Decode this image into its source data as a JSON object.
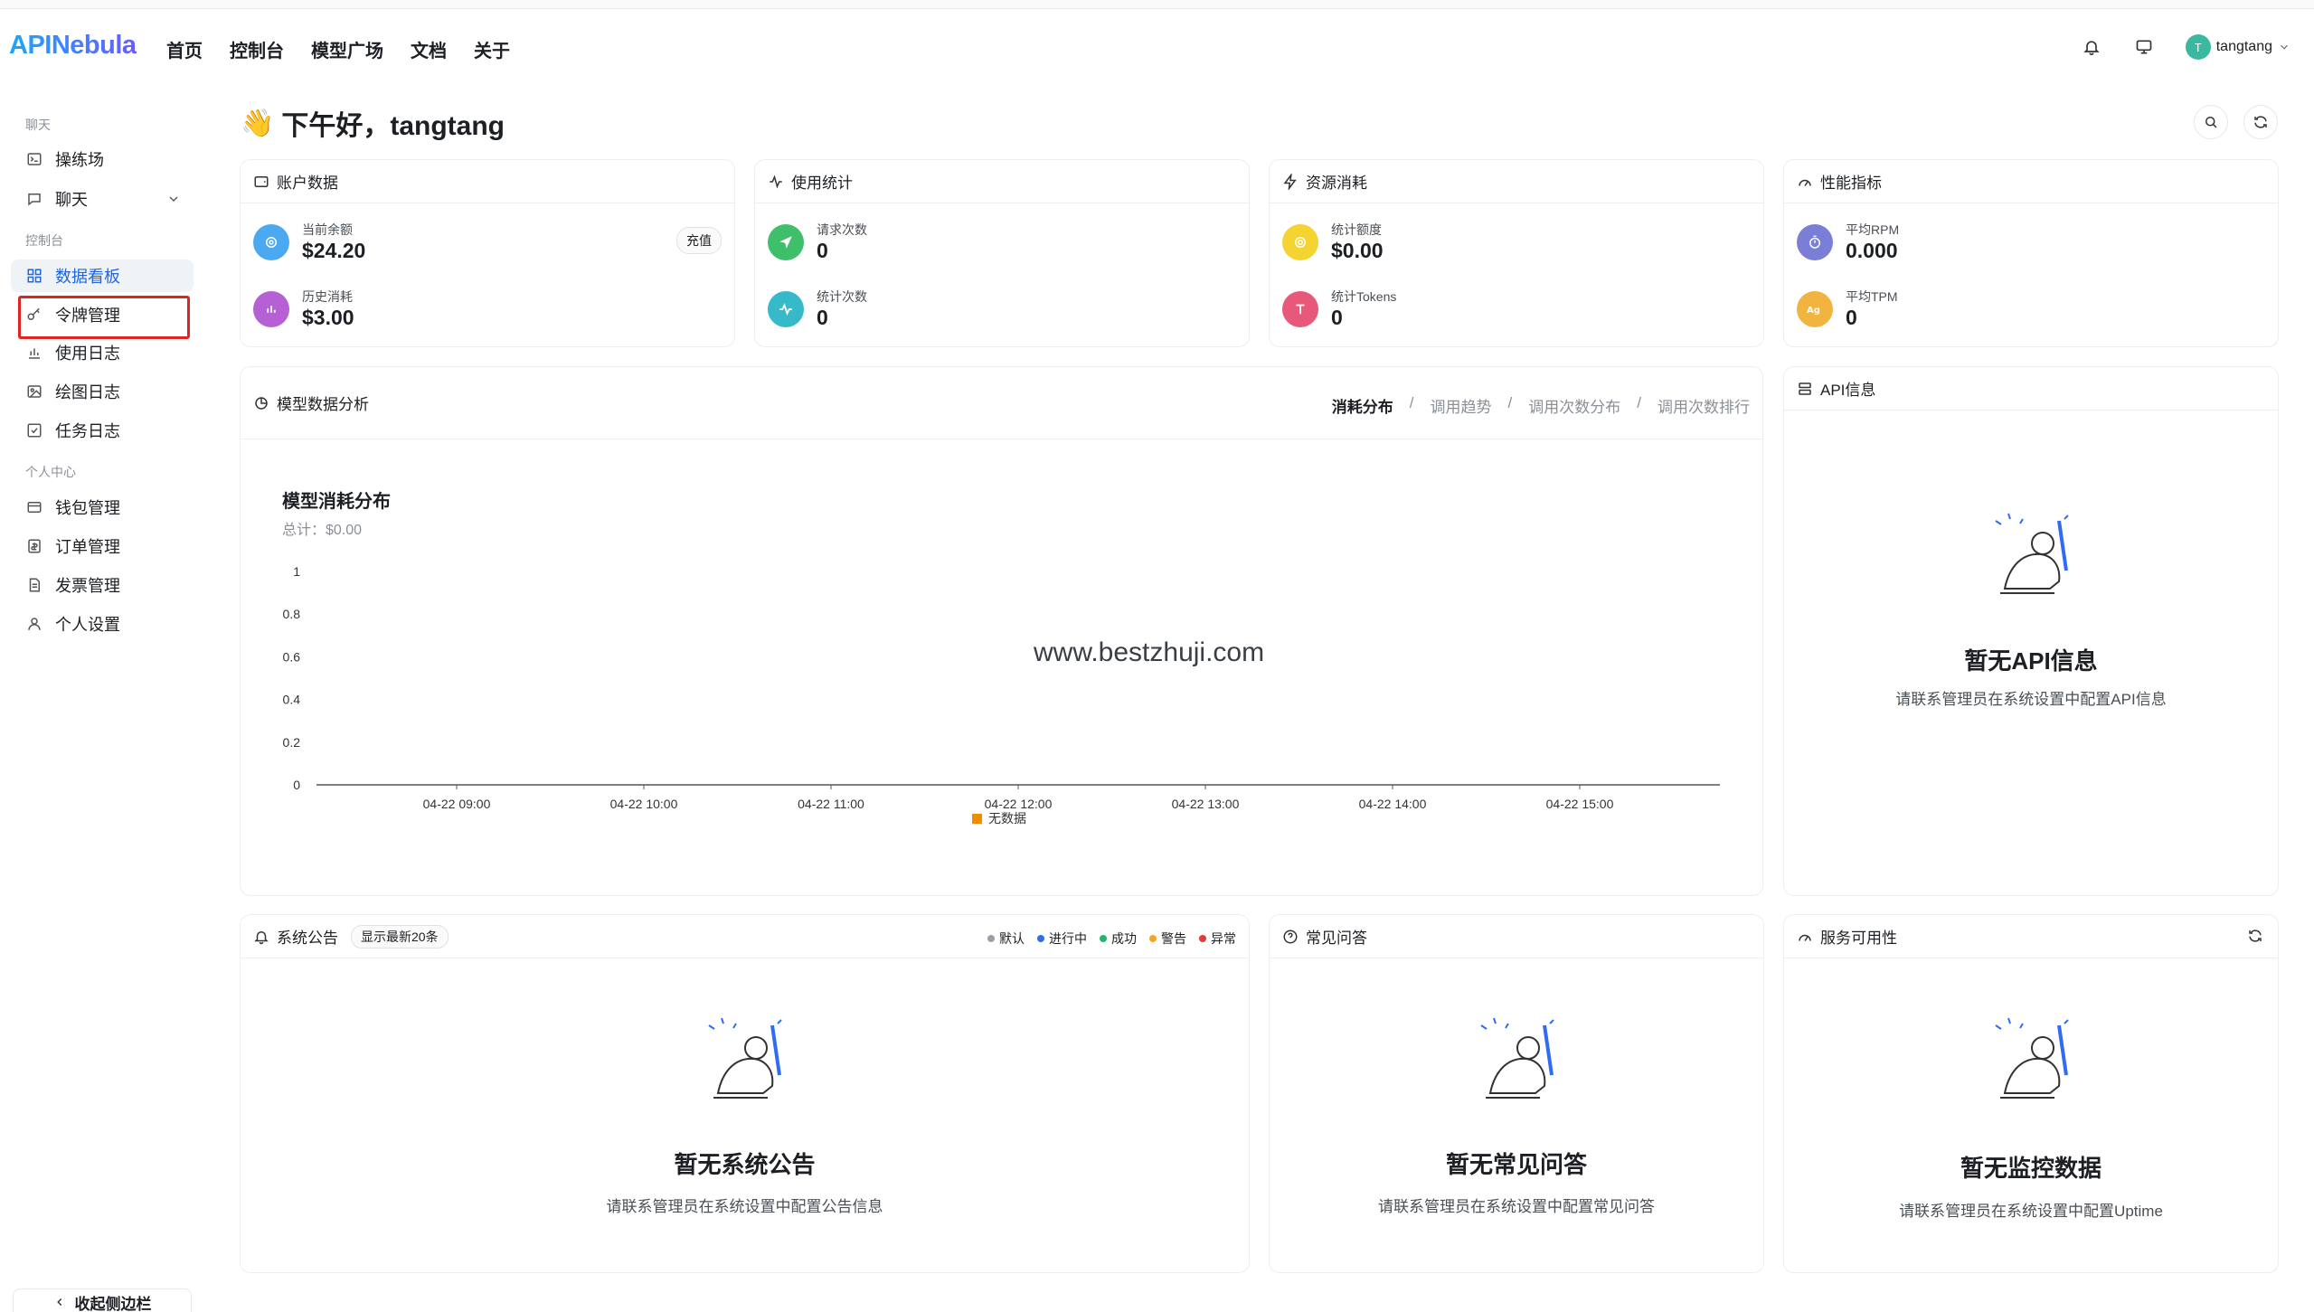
{
  "nav": {
    "logo": "APINebula",
    "links": [
      "首页",
      "控制台",
      "模型广场",
      "文档",
      "关于"
    ],
    "user": {
      "avatar_letter": "T",
      "name": "tangtang"
    }
  },
  "sidebar": {
    "groups": [
      "聊天",
      "控制台",
      "个人中心"
    ],
    "items": [
      {
        "label": "操练场",
        "icon": "terminal-icon"
      },
      {
        "label": "聊天",
        "icon": "chat-icon"
      },
      {
        "label": "数据看板",
        "icon": "grid-icon",
        "active": true
      },
      {
        "label": "令牌管理",
        "icon": "key-icon",
        "highlighted": true
      },
      {
        "label": "使用日志",
        "icon": "bar-chart-icon"
      },
      {
        "label": "绘图日志",
        "icon": "image-icon"
      },
      {
        "label": "任务日志",
        "icon": "check-square-icon"
      },
      {
        "label": "钱包管理",
        "icon": "wallet-icon"
      },
      {
        "label": "订单管理",
        "icon": "order-icon"
      },
      {
        "label": "发票管理",
        "icon": "invoice-icon"
      },
      {
        "label": "个人设置",
        "icon": "user-icon"
      }
    ],
    "collapse_label": "收起侧边栏"
  },
  "greeting": {
    "emoji": "👋",
    "text": "下午好，tangtang"
  },
  "cards": {
    "account": {
      "title": "账户数据",
      "balance_label": "当前余额",
      "balance": "$24.20",
      "recharge": "充值",
      "history_label": "历史消耗",
      "history": "$3.00"
    },
    "usage": {
      "title": "使用统计",
      "requests_label": "请求次数",
      "requests": "0",
      "count_label": "统计次数",
      "count": "0"
    },
    "resource": {
      "title": "资源消耗",
      "quota_label": "统计额度",
      "quota": "$0.00",
      "tokens_label": "统计Tokens",
      "tokens": "0"
    },
    "perf": {
      "title": "性能指标",
      "rpm_label": "平均RPM",
      "rpm": "0.000",
      "tpm_label": "平均TPM",
      "tpm": "0"
    }
  },
  "analysis": {
    "title": "模型数据分析",
    "tabs": [
      "消耗分布",
      "调用趋势",
      "调用次数分布",
      "调用次数排行"
    ],
    "tab_sep": "/",
    "watermark": "www.bestzhuji.com"
  },
  "chart_data": {
    "type": "bar",
    "title": "模型消耗分布",
    "subtitle": "总计：$0.00",
    "categories": [
      "04-22 09:00",
      "04-22 10:00",
      "04-22 11:00",
      "04-22 12:00",
      "04-22 13:00",
      "04-22 14:00",
      "04-22 15:00"
    ],
    "series": [
      {
        "name": "无数据",
        "values": [
          0,
          0,
          0,
          0,
          0,
          0,
          0
        ],
        "color": "#f08c00"
      }
    ],
    "yticks": [
      "1",
      "0.8",
      "0.6",
      "0.4",
      "0.2",
      "0"
    ],
    "ylim": [
      0,
      1
    ],
    "grid": false,
    "legend": "bottom"
  },
  "api_info": {
    "title": "API信息",
    "empty_title": "暂无API信息",
    "empty_desc": "请联系管理员在系统设置中配置API信息"
  },
  "announcements": {
    "title": "系统公告",
    "badge": "显示最新20条",
    "legend": [
      {
        "label": "默认",
        "color": "#9aa0a6"
      },
      {
        "label": "进行中",
        "color": "#2f6cf6"
      },
      {
        "label": "成功",
        "color": "#1fb86a"
      },
      {
        "label": "警告",
        "color": "#f5a623"
      },
      {
        "label": "异常",
        "color": "#e53935"
      }
    ],
    "empty_title": "暂无系统公告",
    "empty_desc": "请联系管理员在系统设置中配置公告信息"
  },
  "faq": {
    "title": "常见问答",
    "empty_title": "暂无常见问答",
    "empty_desc": "请联系管理员在系统设置中配置常见问答"
  },
  "uptime": {
    "title": "服务可用性",
    "empty_title": "暂无监控数据",
    "empty_desc": "请联系管理员在系统设置中配置Uptime"
  }
}
